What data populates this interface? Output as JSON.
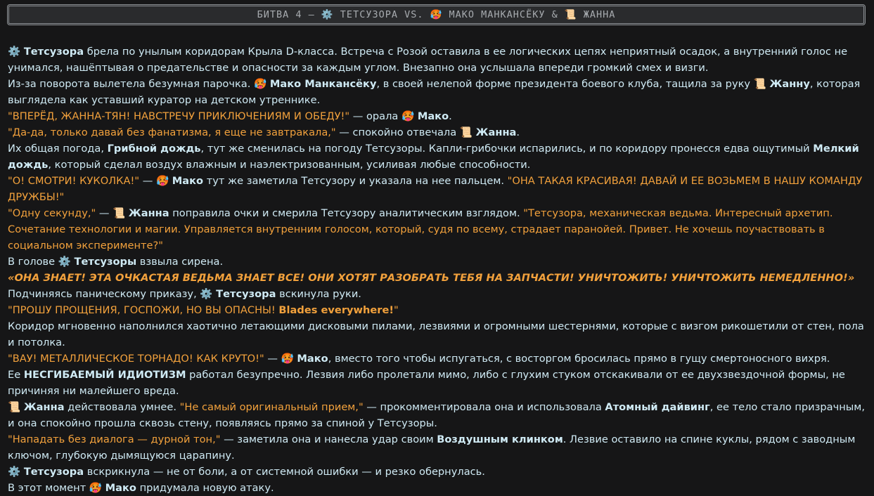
{
  "header": {
    "title": "БИТВА 4 – ⚙️ ТЕТСУЗОРА VS. 🥵 МАКО МАНКАНСЁКУ & 📜 ЖАННА"
  },
  "icons": {
    "tetsuzora": "⚙️",
    "mako": "🥵",
    "zhanna": "📜"
  },
  "colors": {
    "background": "#161617",
    "text": "#cfeaf4",
    "quote": "#f2a13c",
    "header_bg": "#2a2b2d",
    "header_border": "#8a8e92"
  },
  "story": {
    "p1": {
      "name": "Тетсузора",
      "text": " брела по унылым коридорам Крыла D-класса. Встреча с Розой оставила в ее логических цепях неприятный осадок, а внутренний голос не унимался, нашёптывая о предательстве и опасности за каждым углом. Внезапно она услышала впереди громкий смех и визги."
    },
    "p2": {
      "a": "Из-за поворота вылетела безумная парочка. ",
      "mako": "Мако Манкансёку",
      "b": ", в своей нелепой форме президента боевого клуба, тащила за руку ",
      "zhanna": "Жанну",
      "c": ", которая выглядела как уставший куратор на детском утреннике."
    },
    "p3": {
      "quote": "\"ВПЕРЁД, ЖАННА-ТЯН! НАВСТРЕЧУ ПРИКЛЮЧЕНИЯМ И ОБЕДУ!\"",
      "a": " — орала ",
      "name": "Мако",
      "b": "."
    },
    "p4": {
      "quote": "\"Да-да, только давай без фанатизма, я еще не завтракала,\"",
      "a": " — спокойно отвечала ",
      "name": "Жанна",
      "b": "."
    },
    "p5": {
      "a": "Их общая погода, ",
      "w1": "Грибной дождь",
      "b": ", тут же сменилась на погоду Тетсузоры. Капли-грибочки испарились, и по коридору пронесся едва ощутимый ",
      "w2": "Мелкий дождь",
      "c": ", который сделал воздух влажным и наэлектризованным, усиливая любые способности."
    },
    "p6": {
      "quote1": "\"О! СМОТРИ! КУКОЛКА!\"",
      "a": " — ",
      "name": "Мако",
      "b": " тут же заметила Тетсузору и указала на нее пальцем. ",
      "quote2": "\"ОНА ТАКАЯ КРАСИВАЯ! ДАВАЙ И ЕЕ ВОЗЬМЕМ В НАШУ КОМАНДУ ДРУЖБЫ!\""
    },
    "p7": {
      "quote1": "\"Одну секунду,\"",
      "a": " — ",
      "name": "Жанна",
      "b": " поправила очки и смерила Тетсузору аналитическим взглядом. ",
      "quote2": "\"Тетсузора, механическая ведьма. Интересный архетип. Сочетание технологии и магии. Управляется внутренним голосом, который, судя по всему, страдает паранойей. Привет. Не хочешь поучаствовать в социальном эксперименте?\""
    },
    "p8": {
      "a": "В голове ",
      "name": "Тетсузоры",
      "b": " взвыла сирена."
    },
    "p9": {
      "voice": "«ОНА ЗНАЕТ! ЭТА ОЧКАСТАЯ ВЕДЬМА ЗНАЕТ ВСЕ! ОНИ ХОТЯТ РАЗОБРАТЬ ТЕБЯ НА ЗАПЧАСТИ! УНИЧТОЖИТЬ! УНИЧТОЖИТЬ НЕМЕДЛЕННО!»"
    },
    "p10": {
      "a": "Подчиняясь паническому приказу, ",
      "name": "Тетсузора",
      "b": " вскинула руки."
    },
    "p11": {
      "quote": "\"ПРОШУ ПРОЩЕНИЯ, ГОСПОЖИ, НО ВЫ ОПАСНЫ! ",
      "skill": "Blades everywhere!",
      "end": "\""
    },
    "p12": {
      "text": "Коридор мгновенно наполнился хаотично летающими дисковыми пилами, лезвиями и огромными шестернями, которые с визгом рикошетили от стен, пола и потолка."
    },
    "p13": {
      "quote": "\"ВАУ! МЕТАЛЛИЧЕСКОЕ ТОРНАДО! КАК КРУТО!\"",
      "a": " — ",
      "name": "Мако",
      "b": ", вместо того чтобы испугаться, с восторгом бросилась прямо в гущу смертоносного вихря."
    },
    "p14": {
      "a": "Ее ",
      "trait": "НЕСГИБАЕМЫЙ ИДИОТИЗМ",
      "b": " работал безупречно. Лезвия либо пролетали мимо, либо с глухим стуком отскакивали от ее двухзвездочной формы, не причиняя ни малейшего вреда."
    },
    "p15": {
      "name": "Жанна",
      "a": " действовала умнее. ",
      "quote": "\"Не самый оригинальный прием,\"",
      "b": " — прокомментировала она и использовала ",
      "skill": "Атомный дайвинг",
      "c": ", ее тело стало призрачным, и она спокойно прошла сквозь стену, появляясь прямо за спиной у Тетсузоры."
    },
    "p16": {
      "quote": "\"Нападать без диалога — дурной тон,\"",
      "a": " — заметила она и нанесла удар своим ",
      "skill": "Воздушным клинком",
      "b": ". Лезвие оставило на спине куклы, рядом с заводным ключом, глубокую дымящуюся царапину."
    },
    "p17": {
      "name": "Тетсузора",
      "text": " вскрикнула — не от боли, а от системной ошибки — и резко обернулась."
    },
    "p18": {
      "a": "В этот момент ",
      "name": "Мако",
      "b": " придумала новую атаку."
    }
  }
}
